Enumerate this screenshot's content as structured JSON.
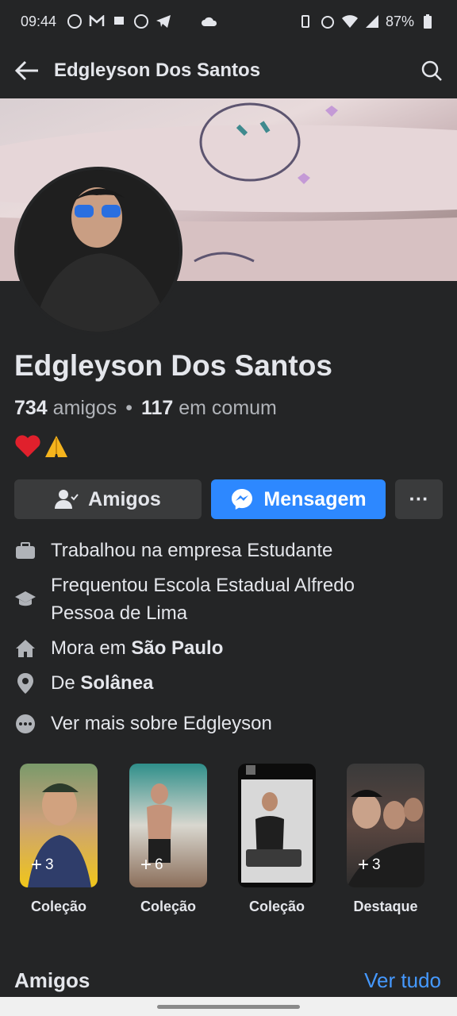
{
  "status_bar": {
    "time": "09:44",
    "battery": "87%"
  },
  "header": {
    "title": "Edgleyson Dos Santos"
  },
  "profile": {
    "name": "Edgleyson Dos Santos",
    "friends_count": "734",
    "friends_label": "amigos",
    "mutual_count": "117",
    "mutual_label": "em comum",
    "bio_emojis": "❤️🙏"
  },
  "actions": {
    "friends": "Amigos",
    "message": "Mensagem",
    "more": "···"
  },
  "info": [
    {
      "icon": "briefcase-icon",
      "text": "Trabalhou na empresa Estudante"
    },
    {
      "icon": "graduation-cap-icon",
      "text": "Frequentou Escola Estadual Alfredo Pessoa de Lima"
    },
    {
      "icon": "home-icon",
      "prefix": "Mora em",
      "bold": "São Paulo"
    },
    {
      "icon": "location-pin-icon",
      "prefix": "De",
      "bold": "Solânea"
    },
    {
      "icon": "more-dots-icon",
      "text": "Ver mais sobre Edgleyson"
    }
  ],
  "stories": [
    {
      "count": "3",
      "label": "Coleção"
    },
    {
      "count": "6",
      "label": "Coleção"
    },
    {
      "count": "",
      "label": "Coleção"
    },
    {
      "count": "3",
      "label": "Destaque"
    }
  ],
  "friends_section": {
    "title": "Amigos",
    "see_all": "Ver tudo"
  },
  "colors": {
    "background": "#242526",
    "accent": "#2d88ff",
    "link": "#4599ff"
  }
}
